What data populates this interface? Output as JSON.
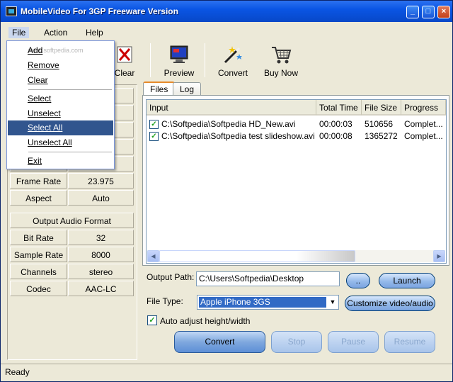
{
  "window": {
    "title": "MobileVideo For 3GP Freeware Version"
  },
  "menubar": {
    "file": "File",
    "action": "Action",
    "help": "Help"
  },
  "file_menu": {
    "add": "Add",
    "remove": "Remove",
    "clear": "Clear",
    "select": "Select",
    "unselect": "Unselect",
    "select_all": "Select All",
    "unselect_all": "Unselect All",
    "exit": "Exit"
  },
  "toolbar": {
    "clear": "Clear",
    "preview": "Preview",
    "convert": "Convert",
    "buy_now": "Buy Now"
  },
  "video_info": {
    "frame_rate_label": "Frame Rate",
    "frame_rate_value": "23.975",
    "aspect_label": "Aspect",
    "aspect_value": "Auto"
  },
  "audio_format": {
    "header": "Output Audio Format",
    "bit_rate_label": "Bit Rate",
    "bit_rate_value": "32",
    "sample_rate_label": "Sample Rate",
    "sample_rate_value": "8000",
    "channels_label": "Channels",
    "channels_value": "stereo",
    "codec_label": "Codec",
    "codec_value": "AAC-LC"
  },
  "tabs": {
    "files": "Files",
    "log": "Log"
  },
  "file_list": {
    "columns": {
      "input": "Input",
      "total_time": "Total Time",
      "file_size": "File Size",
      "progress": "Progress"
    },
    "rows": [
      {
        "input": "C:\\Softpedia\\Softpedia HD_New.avi",
        "total_time": "00:00:03",
        "file_size": "510656",
        "progress": "Complet..."
      },
      {
        "input": "C:\\Softpedia\\Softpedia test slideshow.avi",
        "total_time": "00:00:08",
        "file_size": "1365272",
        "progress": "Complet..."
      }
    ]
  },
  "output": {
    "path_label": "Output Path:",
    "path_value": "C:\\Users\\Softpedia\\Desktop",
    "browse": "..",
    "launch": "Launch",
    "file_type_label": "File Type:",
    "file_type_value": "Apple iPhone 3GS",
    "customize": "Customize video/audio",
    "auto_adjust": "Auto adjust height/width"
  },
  "actions": {
    "convert": "Convert",
    "stop": "Stop",
    "pause": "Pause",
    "resume": "Resume"
  },
  "status": {
    "text": "Ready"
  },
  "watermark": "www.softpedia.com"
}
